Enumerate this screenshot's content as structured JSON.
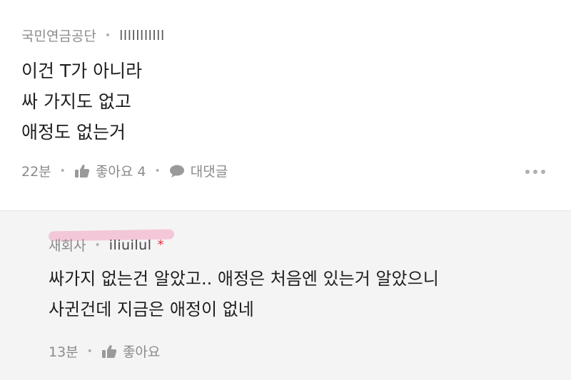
{
  "comments": [
    {
      "author": "국민연금공단",
      "nickname": "lllllllllll",
      "lines": [
        "이건 T가 아니라",
        "싸 가지도 없고",
        "애정도 없는거"
      ],
      "time": "22분",
      "like_label": "좋아요 4",
      "reply_label": "대댓글",
      "more_icon": "more-dots-icon"
    },
    {
      "author": "새회사",
      "nickname": "iliuilul",
      "author_mark": "*",
      "lines": [
        "싸가지 없는건 알았고.. 애정은 처음엔 있는거 알았으니",
        "사귄건데 지금은 애정이 없네"
      ],
      "time": "13분",
      "like_label": "좋아요"
    }
  ],
  "colors": {
    "reply_bg": "#f4f4f4",
    "meta": "#8a8a8a",
    "accent_star": "#e0333a",
    "highlight": "#f3b8cf"
  }
}
